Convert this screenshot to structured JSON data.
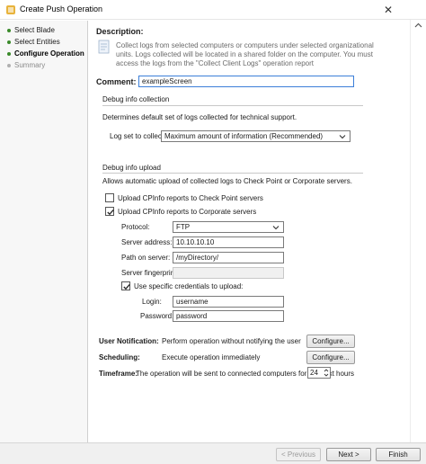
{
  "window": {
    "title": "Create Push Operation",
    "close_glyph": "✕"
  },
  "sidebar": {
    "items": [
      {
        "label": "Select Blade",
        "state": "done"
      },
      {
        "label": "Select Entities",
        "state": "done"
      },
      {
        "label": "Configure Operation",
        "state": "active"
      },
      {
        "label": "Summary",
        "state": "todo"
      }
    ]
  },
  "description": {
    "heading": "Description:",
    "lines": [
      "Collect logs from selected computers or computers under selected organizational",
      "units. Logs collected will be located in a shared folder on the computer. You must",
      "access the logs from the \"Collect Client Logs\" operation report"
    ],
    "icon": "info-document-icon"
  },
  "comment": {
    "label": "Comment:",
    "value": "exampleScreen"
  },
  "debug_collection": {
    "heading": "Debug info collection",
    "text": "Determines default set of logs collected for technical support.",
    "log_set_label": "Log set to collect:",
    "log_set_value": "Maximum amount of information (Recommended)"
  },
  "debug_upload": {
    "heading": "Debug info upload",
    "text": "Allows automatic upload of collected logs to Check Point or Corporate servers.",
    "upload_checkpoint": {
      "label": "Upload CPInfo reports to Check Point servers",
      "checked": false
    },
    "upload_corporate": {
      "label": "Upload CPInfo reports to Corporate servers",
      "checked": true
    },
    "protocol_label": "Protocol:",
    "protocol_value": "FTP",
    "server_address_label": "Server address:",
    "server_address_value": "10.10.10.10",
    "path_label": "Path on server:",
    "path_value": "/myDirectory/",
    "fingerprint_label": "Server fingerprint:",
    "fingerprint_value": "",
    "specific_creds": {
      "label": "Use specific credentials to upload:",
      "checked": true
    },
    "login_label": "Login:",
    "login_value": "username",
    "password_label": "Password:",
    "password_value": "password"
  },
  "user_notification": {
    "label": "User Notification:",
    "text": "Perform operation without notifying the user",
    "button": "Configure..."
  },
  "scheduling": {
    "label": "Scheduling:",
    "text": "Execute operation immediately",
    "button": "Configure..."
  },
  "timeframe": {
    "label": "Timeframe:",
    "text": "The operation will be sent to connected computers for the next",
    "value": "24",
    "unit": "hours"
  },
  "footer": {
    "previous": "< Previous",
    "next": "Next >",
    "finish": "Finish"
  },
  "colors": {
    "accent_blue": "#3c7fd8",
    "step_done": "#3a8a2a",
    "step_todo": "#b0b0b0"
  }
}
